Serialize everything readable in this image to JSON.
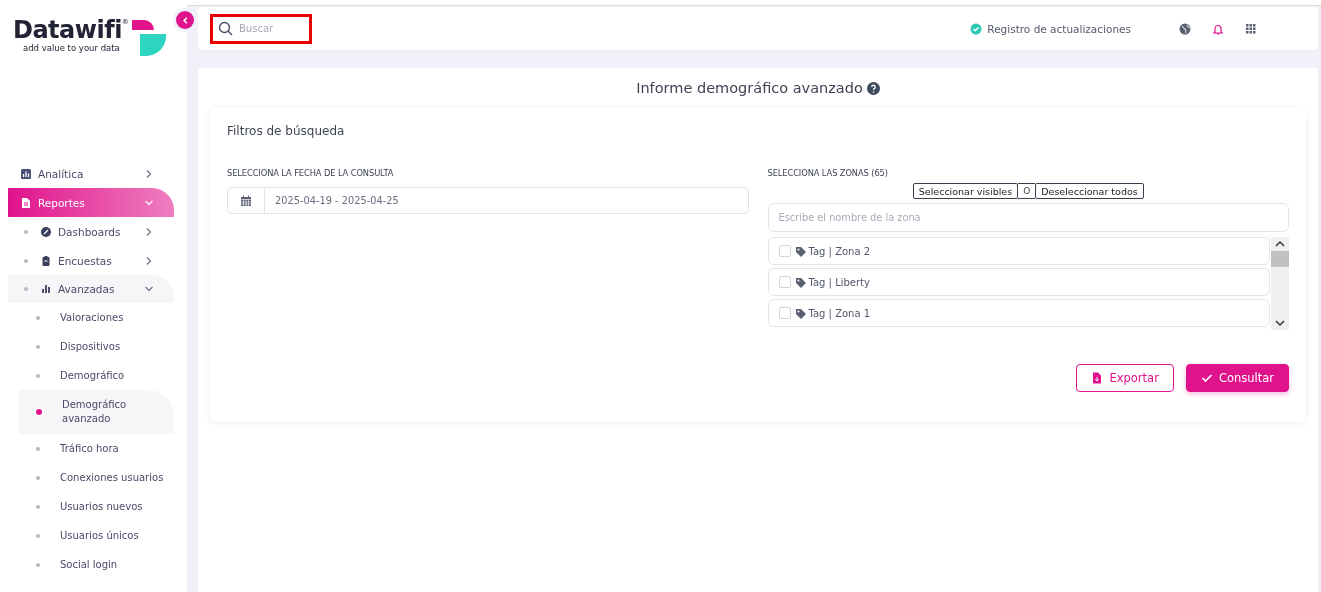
{
  "logo": {
    "name": "Datawifi",
    "mark": "®",
    "tagline": "add value to your data"
  },
  "sidebar": {
    "items": [
      {
        "label": "Analítica",
        "expanded": false,
        "selected": false
      },
      {
        "label": "Reportes",
        "expanded": true,
        "selected": true,
        "children": [
          {
            "label": "Dashboards",
            "expanded": false
          },
          {
            "label": "Encuestas",
            "expanded": false
          },
          {
            "label": "Avanzadas",
            "expanded": true,
            "children": [
              {
                "label": "Valoraciones",
                "selected": false
              },
              {
                "label": "Dispositivos",
                "selected": false
              },
              {
                "label": "Demográfico",
                "selected": false
              },
              {
                "label": "Demográfico avanzado",
                "selected": true
              },
              {
                "label": "Tráfico hora",
                "selected": false
              },
              {
                "label": "Conexiones usuarios",
                "selected": false
              },
              {
                "label": "Usuarios nuevos",
                "selected": false
              },
              {
                "label": "Usuarios únicos",
                "selected": false
              },
              {
                "label": "Social login",
                "selected": false
              }
            ]
          }
        ]
      }
    ]
  },
  "topbar": {
    "search": {
      "placeholder": "Buscar",
      "highlighted": true
    },
    "changelog": "Registro de actualizaciones"
  },
  "page": {
    "title": "Informe demográfico avanzado",
    "filters": {
      "title": "Filtros de búsqueda",
      "date": {
        "label": "SELECCIONA LA FECHA DE LA CONSULTA",
        "value": "2025-04-19 - 2025-04-25"
      },
      "zones": {
        "label": "SELECCIONA LAS ZONAS (65)",
        "select_visible": "Seleccionar visibles",
        "separator": "O",
        "deselect_all": "Deseleccionar todos",
        "placeholder": "Escribe el nombre de la zona",
        "items": [
          {
            "label": "Tag | Zona 2",
            "checked": false
          },
          {
            "label": "Tag | Liberty",
            "checked": false
          },
          {
            "label": "Tag | Zona 1",
            "checked": false
          }
        ]
      },
      "buttons": [
        {
          "label": "Exportar",
          "kind": "outline"
        },
        {
          "label": "Consultar",
          "kind": "primary"
        }
      ]
    }
  }
}
